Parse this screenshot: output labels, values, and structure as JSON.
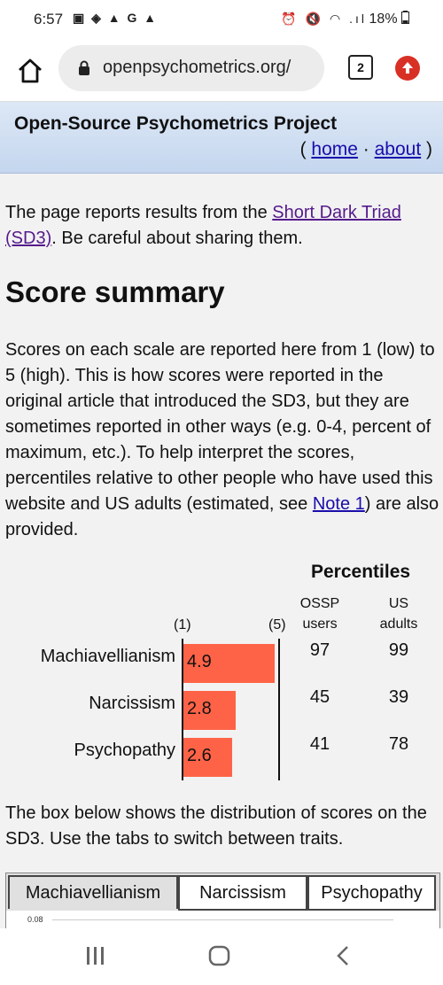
{
  "status_bar": {
    "time": "6:57",
    "left_icons": "▣ ◈ ▲ G ▲",
    "battery": "18%",
    "right_icons": "⏰ 🔇 ◠ .ıl"
  },
  "browser": {
    "url": "openpsychometrics.org/",
    "tab_count": "2"
  },
  "site": {
    "title": "Open-Source Psychometrics Project",
    "nav_open": "( ",
    "home": "home",
    "sep": " · ",
    "about": "about",
    "nav_close": " )"
  },
  "intro": {
    "pre": "The page reports results from the ",
    "link": "Short Dark Triad (SD3)",
    "post": ". Be careful about sharing them."
  },
  "heading": "Score summary",
  "summary": {
    "pre": "Scores on each scale are reported here from 1 (low) to 5 (high). This is how scores were reported in the original article that introduced the SD3, but they are sometimes reported in other ways (e.g. 0-4, percent of maximum, etc.). To help interpret the scores, percentiles relative to other people who have used this website and US adults (estimated, see ",
    "link": "Note 1",
    "post": ") are also provided."
  },
  "table": {
    "percentiles_label": "Percentiles",
    "ossp_label": "OSSP users",
    "us_label": "US adults",
    "scale_min": "(1)",
    "scale_max": "(5)",
    "rows": [
      {
        "trait": "Machiavellianism",
        "score": "4.9",
        "ossp": "97",
        "us": "99"
      },
      {
        "trait": "Narcissism",
        "score": "2.8",
        "ossp": "45",
        "us": "39"
      },
      {
        "trait": "Psychopathy",
        "score": "2.6",
        "ossp": "41",
        "us": "78"
      }
    ]
  },
  "distribution_text": "The box below shows the distribution of scores on the SD3. Use the tabs to switch between traits.",
  "tabs": [
    "Machiavellianism",
    "Narcissism",
    "Psychopathy"
  ],
  "chart_tick": "0.08",
  "colors": {
    "bar": "#ff6347",
    "link": "#1a0dab",
    "visited": "#551a8b"
  }
}
